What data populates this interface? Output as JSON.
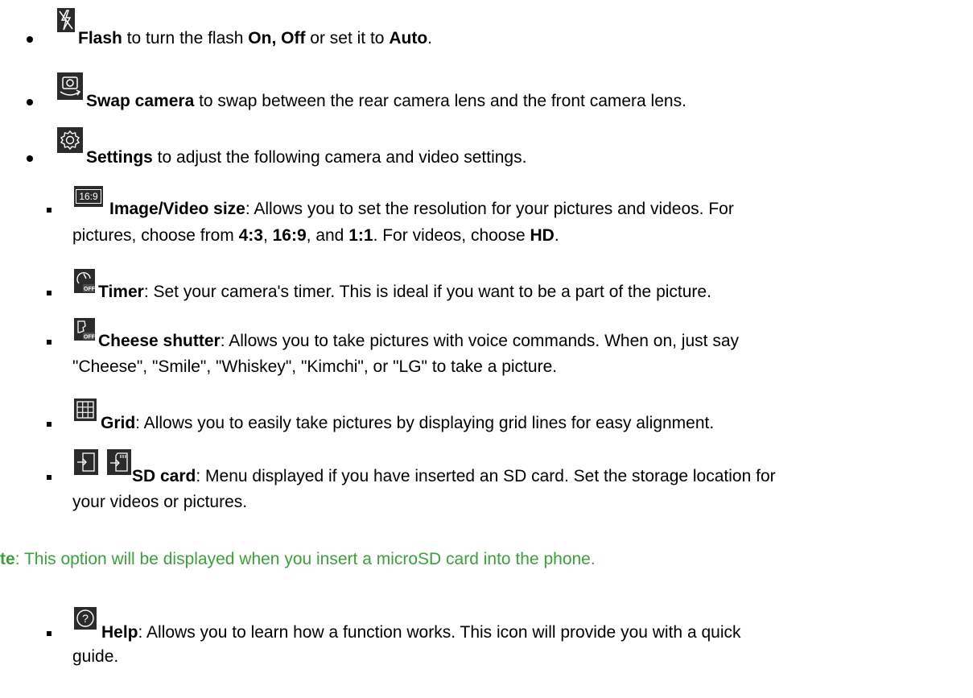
{
  "items": {
    "flash": {
      "label": "Flash",
      "t1": " to turn the flash ",
      "on_off": "On, Off",
      "t2": " or set it to ",
      "auto": "Auto",
      "t3": "."
    },
    "swap": {
      "label": "Swap camera",
      "t1": " to swap between the rear camera lens and the front camera lens."
    },
    "settings": {
      "label": "Settings",
      "t1": " to adjust the following camera and video settings."
    },
    "image_size": {
      "icon_text": "16:9",
      "label": "Image/Video size",
      "t1": ": Allows you to set the resolution for your pictures and videos. For",
      "line2_t1": "pictures, choose from ",
      "r1": "4:3",
      "sep1": ", ",
      "r2": "16:9",
      "sep2": ", and ",
      "r3": "1:1",
      "line2_t2": ". For videos, choose ",
      "hd": "HD",
      "line2_t3": "."
    },
    "timer": {
      "label": "Timer",
      "t1": ": Set your camera's timer. This is ideal if you want to be a part of the picture."
    },
    "cheese": {
      "label": "Cheese shutter",
      "t1": ": Allows you to take pictures with voice commands. When on, just say",
      "line2": "\"Cheese\", \"Smile\", \"Whiskey\", \"Kimchi\", or \"LG\" to take a picture."
    },
    "grid": {
      "label": "Grid",
      "t1": ": Allows you to easily take pictures by displaying grid lines for easy alignment."
    },
    "sdcard": {
      "label": "SD card",
      "t1": ": Menu displayed if you have inserted an SD card. Set the storage location for",
      "line2": "your videos or pictures."
    },
    "note": {
      "prefix": "te",
      "t1": ": This option will be displayed when you insert a microSD card into the phone."
    },
    "help": {
      "label": "Help",
      "t1": ": Allows you to learn how a function works. This icon will provide you with a quick",
      "line2": "guide."
    }
  },
  "icons": [
    "flash-off-icon",
    "swap-camera-icon",
    "settings-gear-icon",
    "aspect-ratio-icon",
    "timer-off-icon",
    "cheese-shutter-off-icon",
    "grid-icon",
    "storage-internal-icon",
    "storage-sd-icon",
    "help-icon"
  ],
  "colors": {
    "note": "#3aa13a",
    "text": "#000000"
  }
}
